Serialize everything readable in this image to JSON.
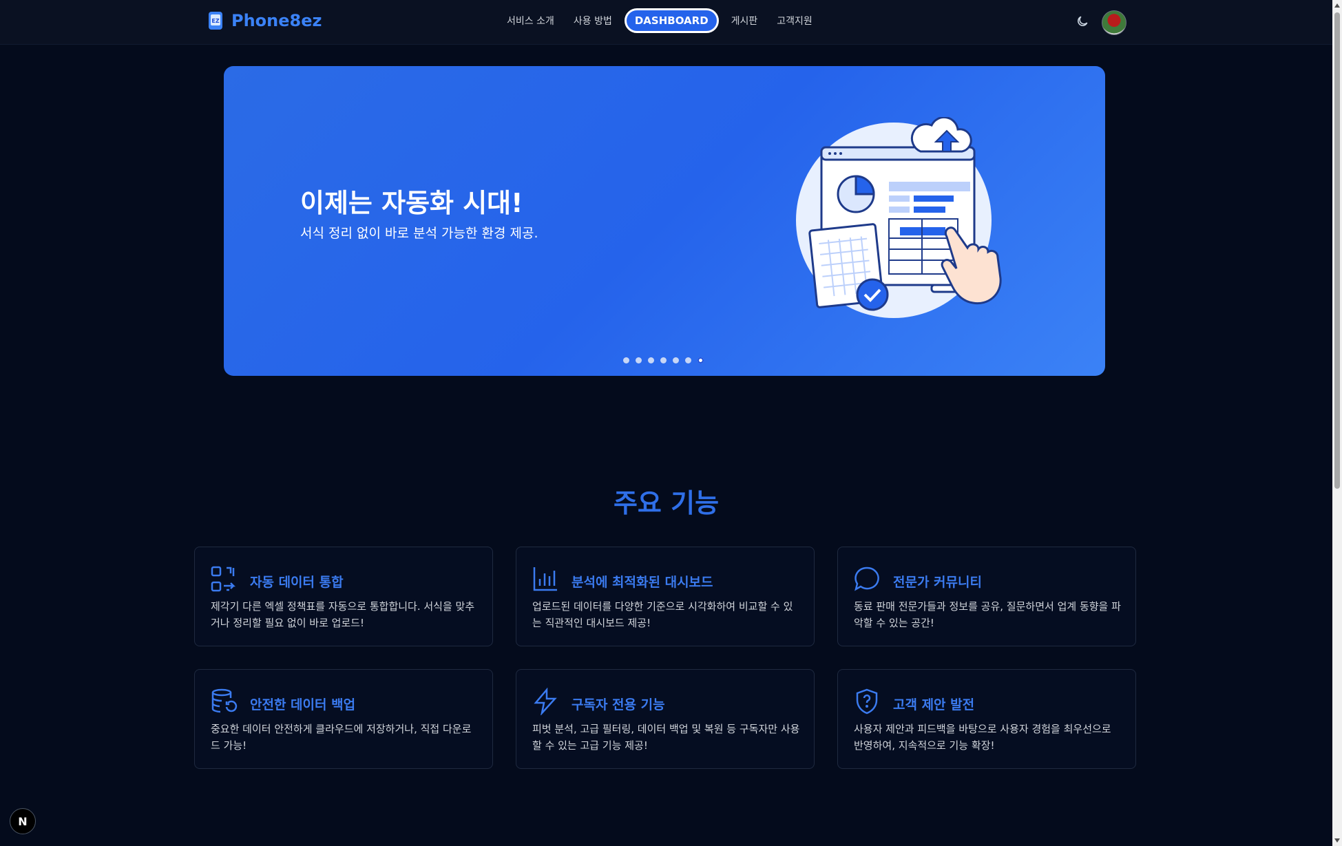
{
  "header": {
    "logo_text": "Phone8ez",
    "logo_badge": "EZ",
    "nav": [
      "서비스 소개",
      "사용 방법",
      "DASHBOARD",
      "게시판",
      "고객지원"
    ],
    "active_nav": "DASHBOARD"
  },
  "hero": {
    "title": "이제는 자동화 시대!",
    "subtitle": "서식 정리 없이 바로 분석 가능한 환경 제공.",
    "slide_count": 7,
    "active_slide": 7
  },
  "features": {
    "title": "주요 기능",
    "items": [
      {
        "icon": "data-merge-icon",
        "title": "자동 데이터 통합",
        "desc": "제각기 다른 엑셀 정책표를 자동으로 통합합니다. 서식을 맞추거나 정리할 필요 없이 바로 업로드!"
      },
      {
        "icon": "bar-chart-icon",
        "title": "분석에 최적화된 대시보드",
        "desc": "업로드된 데이터를 다양한 기준으로 시각화하여 비교할 수 있는 직관적인 대시보드 제공!"
      },
      {
        "icon": "chat-bubble-icon",
        "title": "전문가 커뮤니티",
        "desc": "동료 판매 전문가들과 정보를 공유, 질문하면서 업계 동향을 파악할 수 있는 공간!"
      },
      {
        "icon": "database-restore-icon",
        "title": "안전한 데이터 백업",
        "desc": "중요한 데이터 안전하게 클라우드에 저장하거나, 직접 다운로드 가능!"
      },
      {
        "icon": "lightning-icon",
        "title": "구독자 전용 기능",
        "desc": "피벗 분석, 고급 필터링, 데이터 백업 및 복원 등 구독자만 사용할 수 있는 고급 기능 제공!"
      },
      {
        "icon": "shield-question-icon",
        "title": "고객 제안 발전",
        "desc": "사용자 제안과 피드백을 바탕으로 사용자 경험을 최우선으로 반영하여, 지속적으로 기능 확장!"
      }
    ]
  },
  "dev_badge": "N",
  "colors": {
    "accent": "#2563eb",
    "background": "#040b1c",
    "card_title": "#3b7bf0"
  }
}
